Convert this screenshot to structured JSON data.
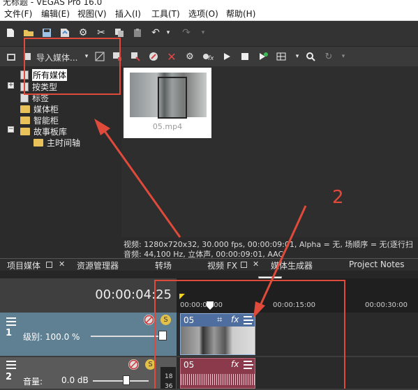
{
  "app": {
    "title_fragment": "无标题 - VEGAS Pro 16.0"
  },
  "menu": [
    {
      "label": "文件(F)"
    },
    {
      "label": "编辑(E)"
    },
    {
      "label": "视图(V)"
    },
    {
      "label": "插入(I)"
    },
    {
      "label": "工具(T)"
    },
    {
      "label": "选项(O)"
    },
    {
      "label": "帮助(H)"
    }
  ],
  "media_toolbar": {
    "import_label": "导入媒体..."
  },
  "tree": {
    "items": [
      {
        "label": "所有媒体"
      },
      {
        "label": "按类型"
      },
      {
        "label": "标签"
      },
      {
        "label": "媒体柜"
      },
      {
        "label": "智能柜"
      },
      {
        "label": "故事板库"
      },
      {
        "label": "主时间轴"
      }
    ]
  },
  "media": {
    "file_name": "05.mp4"
  },
  "info": {
    "video": "视频: 1280x720x32, 30.000 fps, 00:00:09:01, Alpha = 无, 场顺序 = 无(逐行扫",
    "audio": "音频: 44,100 Hz, 立体声, 00:00:09:01, AAC"
  },
  "tabs": [
    {
      "label": "项目媒体"
    },
    {
      "label": "资源管理器"
    },
    {
      "label": "转场"
    },
    {
      "label": "视频 FX"
    },
    {
      "label": "媒体生成器"
    },
    {
      "label": "Project Notes"
    }
  ],
  "timeline": {
    "timecode": "00:00:04:25",
    "ruler": [
      "00:00:00:00",
      "00:00:15:00",
      "00:00:30:00"
    ],
    "video_track": {
      "number": "1",
      "level_label": "级别: 100.0 %",
      "clip_name": "05"
    },
    "audio_track": {
      "number": "2",
      "volume_label": "音量:",
      "volume_value": "0.0 dB",
      "meter_a": "18",
      "meter_b": "36",
      "clip_name": "05"
    }
  },
  "annotation": {
    "label": "2",
    "color": "#e04a3a"
  }
}
